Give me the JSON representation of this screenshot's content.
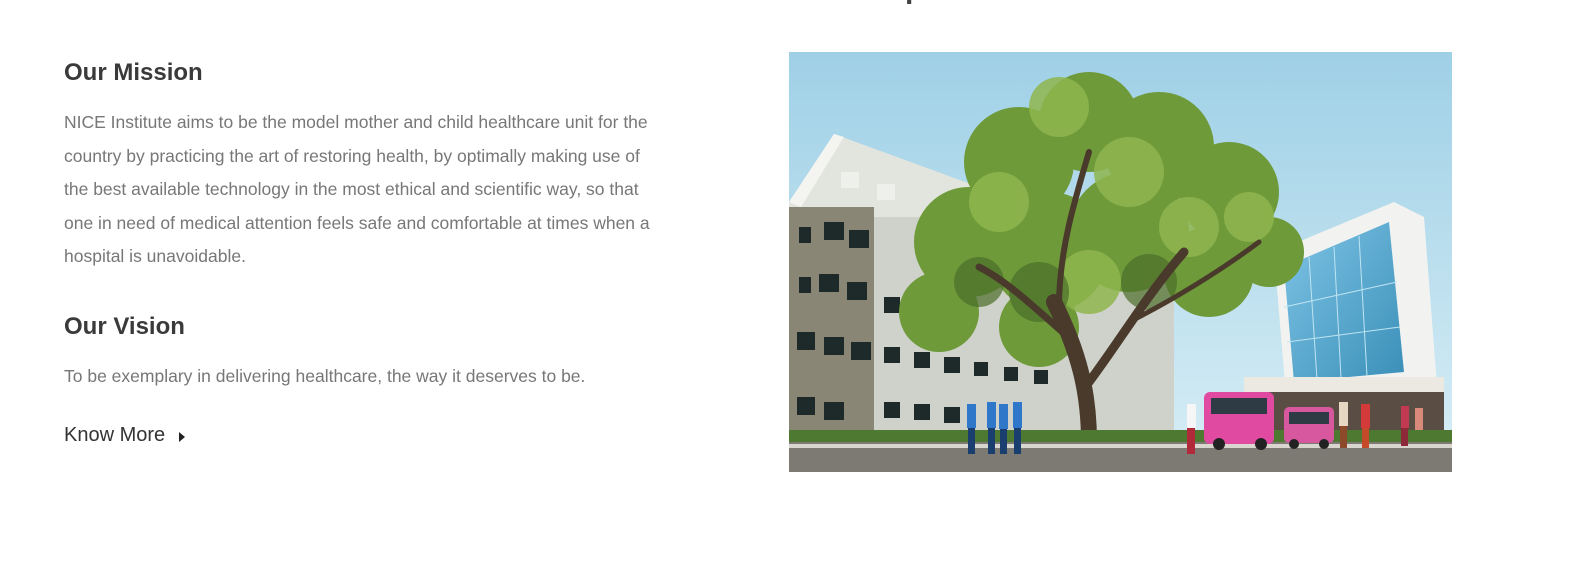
{
  "header": {
    "partial_heading": "p"
  },
  "mission": {
    "title": "Our Mission",
    "text": "NICE Institute aims to be the model mother and child healthcare unit for the country by practicing the art of restoring health, by optimally making use of the best available technology in the most ethical and scientific way, so that one in need of medical attention feels safe and comfortable at times when a hospital is unavoidable."
  },
  "vision": {
    "title": "Our Vision",
    "text": "To be exemplary in delivering healthcare, the way it deserves to be."
  },
  "cta": {
    "know_more_label": "Know More",
    "icon": "caret-right-icon"
  },
  "image": {
    "subject": "hospital-building-photo"
  }
}
